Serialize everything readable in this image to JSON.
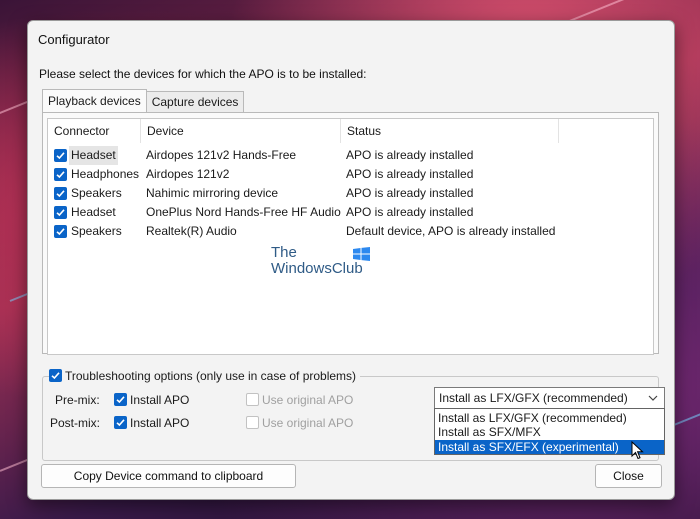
{
  "window": {
    "title": "Configurator",
    "instruction": "Please select the devices for which the APO is to be installed:"
  },
  "tabs": [
    {
      "label": "Playback devices",
      "active": true
    },
    {
      "label": "Capture devices",
      "active": false
    }
  ],
  "device_list": {
    "columns": [
      "Connector",
      "Device",
      "Status"
    ],
    "rows": [
      {
        "checked": true,
        "connector": "Headset",
        "device": "Airdopes 121v2 Hands-Free",
        "status": "APO is already installed"
      },
      {
        "checked": true,
        "connector": "Headphones",
        "device": "Airdopes 121v2",
        "status": "APO is already installed"
      },
      {
        "checked": true,
        "connector": "Speakers",
        "device": "Nahimic mirroring device",
        "status": "APO is already installed"
      },
      {
        "checked": true,
        "connector": "Headset",
        "device": "OnePlus Nord Hands-Free HF Audio",
        "status": "APO is already installed"
      },
      {
        "checked": true,
        "connector": "Speakers",
        "device": "Realtek(R) Audio",
        "status": "Default device, APO is already installed"
      }
    ]
  },
  "watermark": {
    "line1": "The",
    "line2": "WindowsClub"
  },
  "troubleshooting": {
    "checked": true,
    "label": "Troubleshooting options (only use in case of problems)",
    "premix_label": "Pre-mix:",
    "postmix_label": "Post-mix:",
    "install_apo_label": "Install APO",
    "use_original_label": "Use original APO",
    "premix_install_checked": true,
    "postmix_install_checked": true,
    "premix_original_checked": false,
    "postmix_original_checked": false
  },
  "install_mode": {
    "selected": "Install as LFX/GFX (recommended)",
    "options": [
      "Install as LFX/GFX (recommended)",
      "Install as SFX/MFX",
      "Install as SFX/EFX (experimental)"
    ],
    "highlighted_index": 2
  },
  "buttons": {
    "copy": "Copy Device command to clipboard",
    "close": "Close"
  },
  "colors": {
    "accent": "#0a64c8",
    "watermark": "#2f5b86"
  }
}
